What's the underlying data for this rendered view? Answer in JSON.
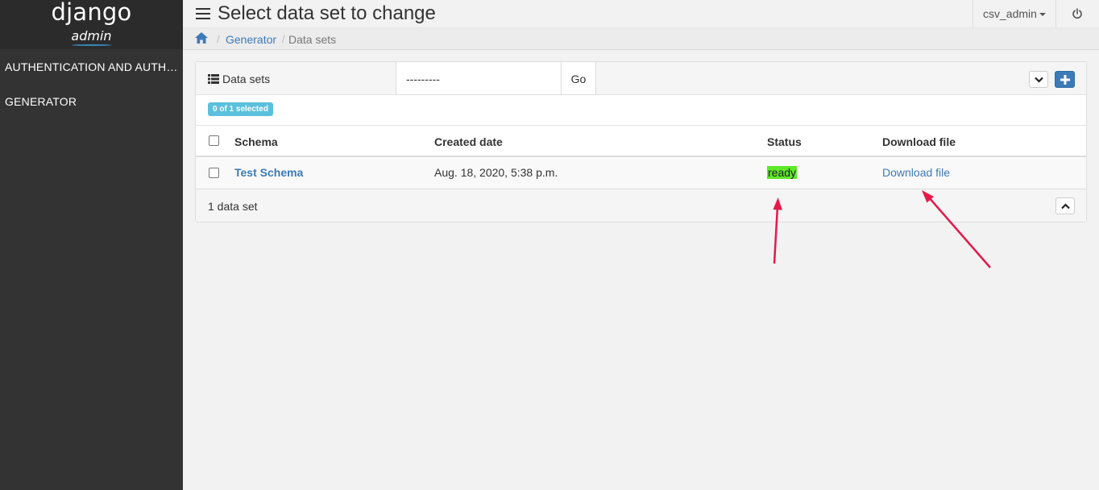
{
  "sidebar": {
    "brand_title": "django",
    "brand_subtitle": "admin",
    "items": [
      {
        "label": "AUTHENTICATION AND AUTH…"
      },
      {
        "label": "GENERATOR"
      }
    ]
  },
  "header": {
    "title": "Select data set to change",
    "user": "csv_admin",
    "menu_icon": "hamburger-icon",
    "logout_icon": "power-icon"
  },
  "breadcrumb": {
    "home_icon": "home-icon",
    "separator": "/",
    "items": [
      "Generator",
      "Data sets"
    ]
  },
  "panel": {
    "title": "Data sets",
    "action_value": "---------",
    "go_label": "Go",
    "selected_badge": "0 of 1 selected",
    "columns": [
      "Schema",
      "Created date",
      "Status",
      "Download file"
    ],
    "rows": [
      {
        "schema": "Test Schema",
        "created": "Aug. 18, 2020, 5:38 p.m.",
        "status": "ready",
        "download": "Download file"
      }
    ],
    "footer": "1 data set"
  },
  "colors": {
    "sidebar": "#333333",
    "link": "#3c7ab8",
    "status_ready": "#5ee829",
    "badge": "#5bc0de",
    "annotation_arrow": "#e5194b"
  }
}
